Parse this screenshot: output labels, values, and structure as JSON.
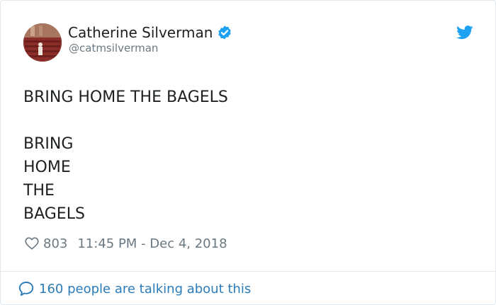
{
  "author": {
    "name": "Catherine Silverman",
    "handle": "@catmsilverman",
    "verified_icon": "verified-badge-icon",
    "avatar_icon": "avatar"
  },
  "brand": {
    "icon": "twitter-bird-icon",
    "color": "#1da1f2"
  },
  "tweet": {
    "line1": "BRING HOME THE BAGELS",
    "stack": [
      "BRING",
      "HOME",
      "THE",
      "BAGELS"
    ]
  },
  "meta": {
    "likes": "803",
    "timestamp": "11:45 PM - Dec 4, 2018",
    "like_icon": "heart-icon"
  },
  "footer": {
    "talking": "160 people are talking about this",
    "icon": "speech-bubble-icon",
    "color": "#2b7bb9"
  }
}
